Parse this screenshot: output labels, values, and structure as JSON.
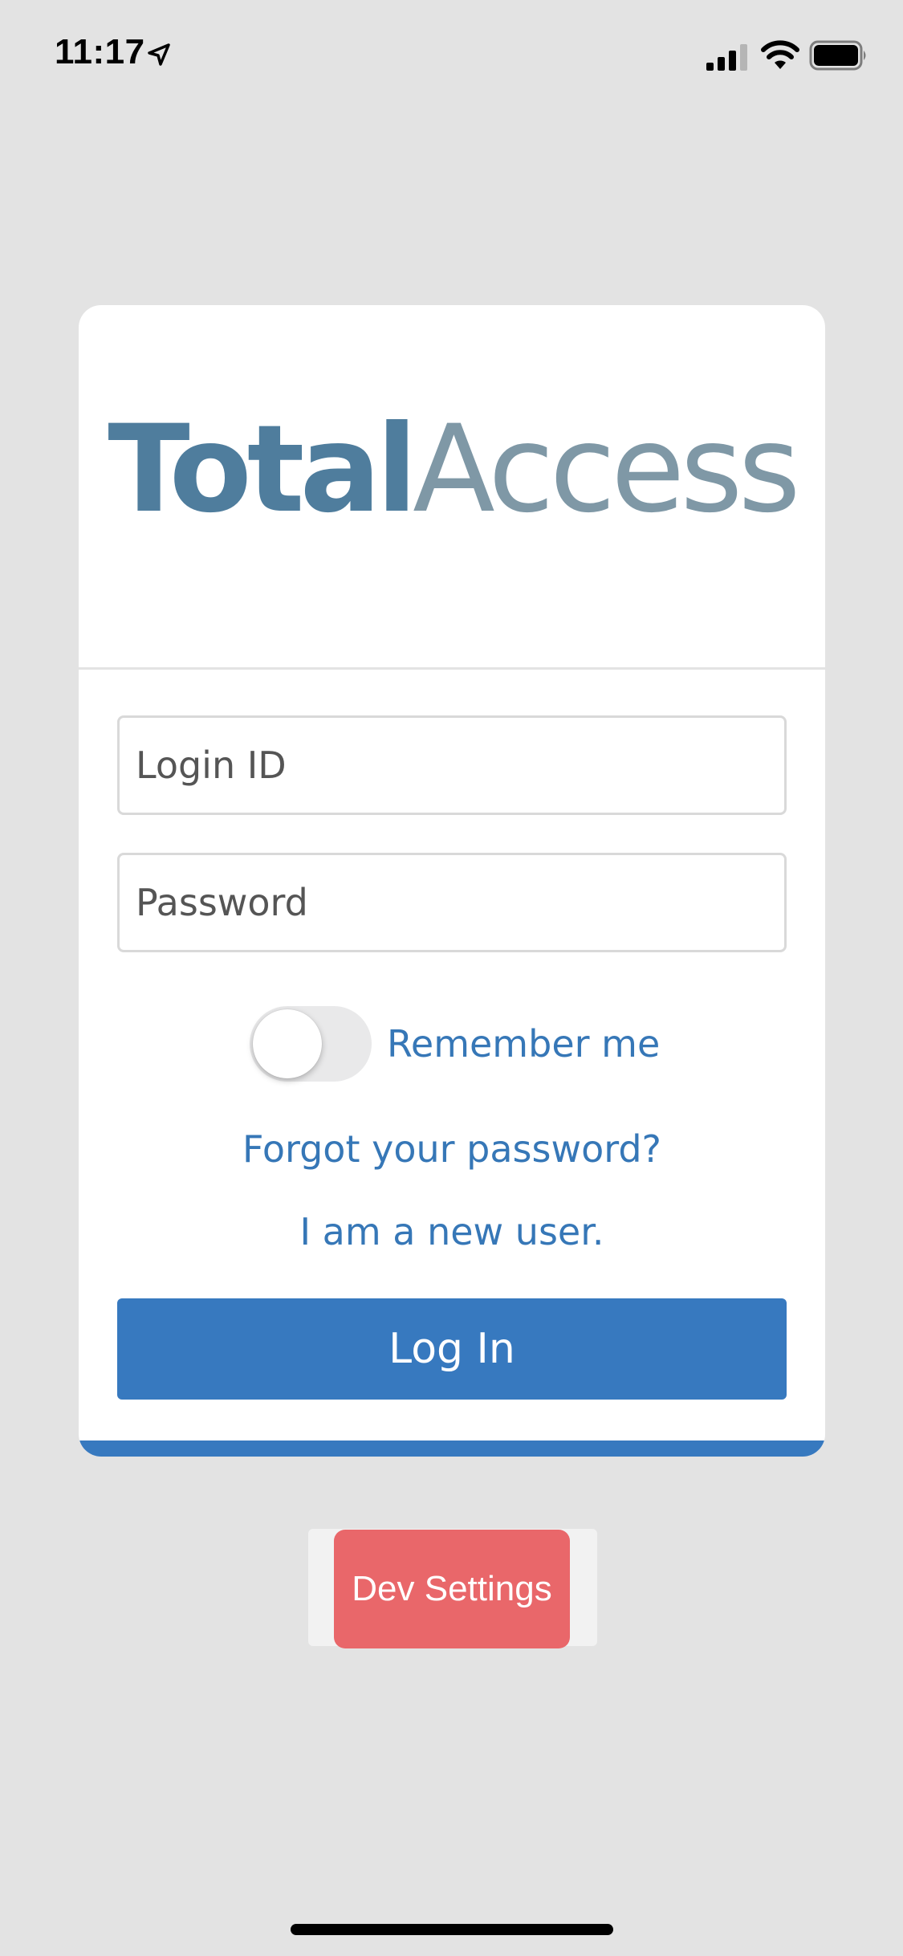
{
  "status_bar": {
    "time": "11:17",
    "icons": [
      "location-arrow-icon",
      "cellular-signal-icon",
      "wifi-icon",
      "battery-icon"
    ]
  },
  "logo": {
    "bold_part": "Total",
    "light_part": "Access",
    "bold_color": "#4f7d9d",
    "light_color": "#7f98a6"
  },
  "form": {
    "login_placeholder": "Login ID",
    "login_value": "",
    "password_placeholder": "Password",
    "password_value": "",
    "remember_label": "Remember me",
    "remember_on": false,
    "forgot_link": "Forgot your password?",
    "new_user_link": "I am a new user.",
    "login_button": "Log In"
  },
  "dev": {
    "button_label": "Dev Settings",
    "button_color": "#e9676a"
  },
  "colors": {
    "accent": "#3779bf",
    "link": "#3677b7",
    "background": "#e3e3e3"
  }
}
